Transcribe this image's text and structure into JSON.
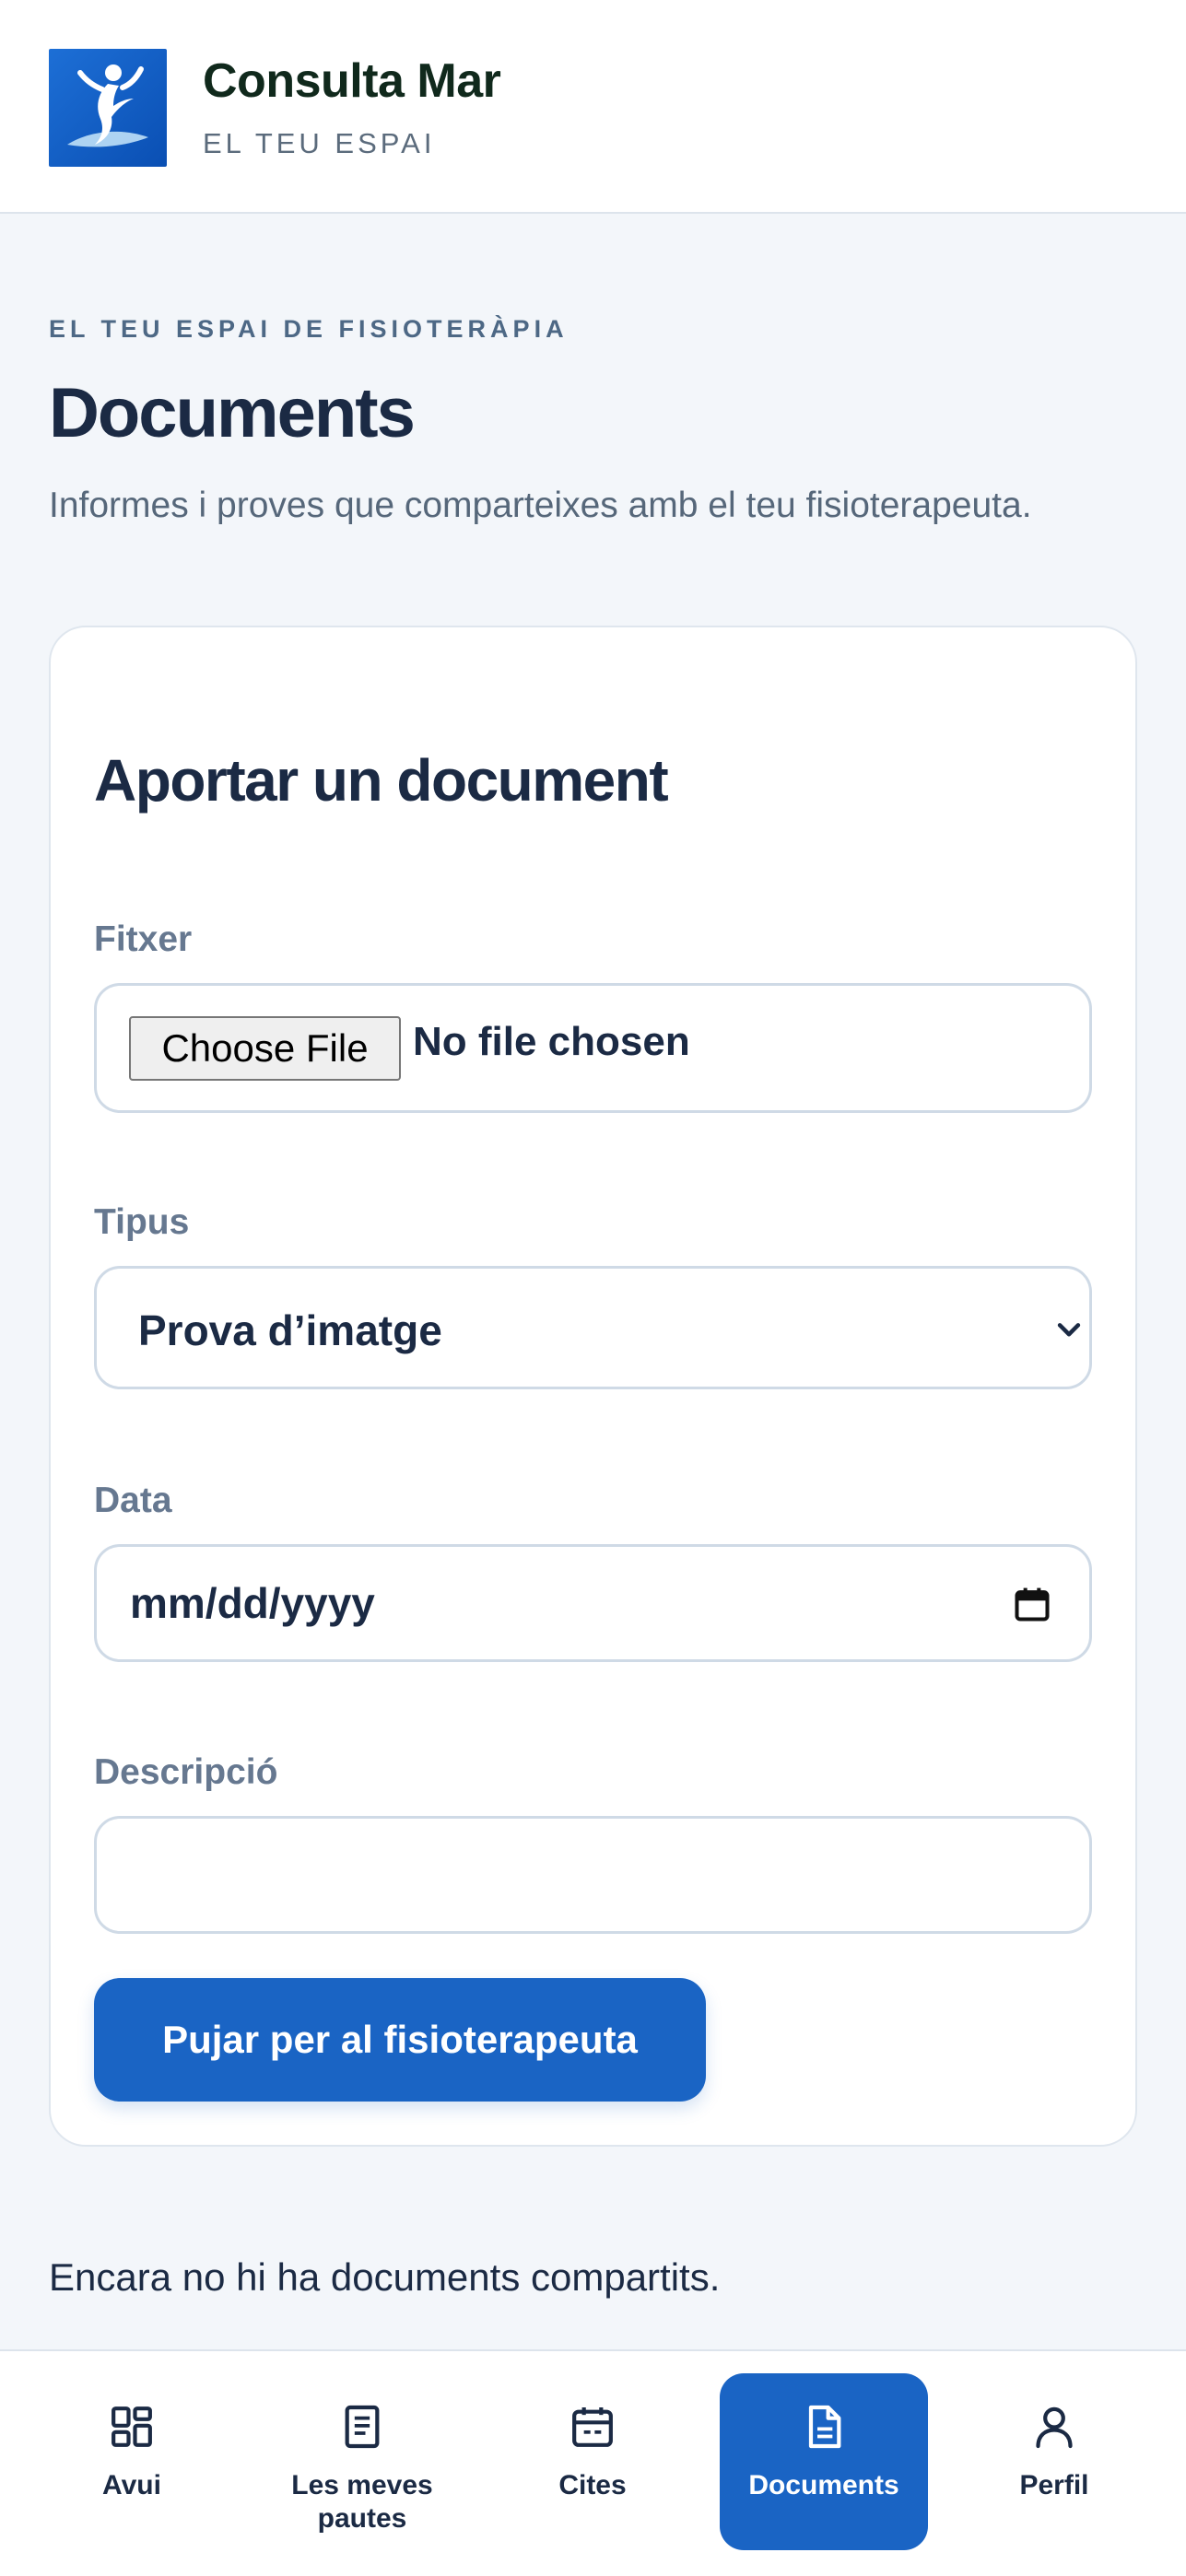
{
  "header": {
    "brand_name": "Consulta Mar",
    "brand_subtitle": "EL TEU ESPAI"
  },
  "page": {
    "eyebrow": "EL TEU ESPAI DE FISIOTERÀPIA",
    "title": "Documents",
    "description": "Informes i proves que comparteixes amb el teu fisioterapeuta."
  },
  "upload_form": {
    "title": "Aportar un document",
    "file_label": "Fitxer",
    "file_button": "Choose File",
    "file_status": "No file chosen",
    "type_label": "Tipus",
    "type_value": "Prova d’imatge",
    "date_label": "Data",
    "date_placeholder": "mm/dd/yyyy",
    "description_label": "Descripció",
    "description_value": "",
    "submit_label": "Pujar per al fisioterapeuta"
  },
  "empty_state": "Encara no hi ha documents compartits.",
  "bottom_nav": {
    "items": [
      {
        "label": "Avui",
        "icon": "dashboard-grid-icon",
        "active": false
      },
      {
        "label": "Les meves pautes",
        "icon": "document-list-icon",
        "active": false
      },
      {
        "label": "Cites",
        "icon": "calendar-icon",
        "active": false
      },
      {
        "label": "Documents",
        "icon": "file-icon",
        "active": true
      },
      {
        "label": "Perfil",
        "icon": "user-icon",
        "active": false
      }
    ]
  },
  "colors": {
    "accent": "#1a64c4",
    "background": "#f3f6fa",
    "text": "#1b2a44",
    "muted": "#667890"
  }
}
